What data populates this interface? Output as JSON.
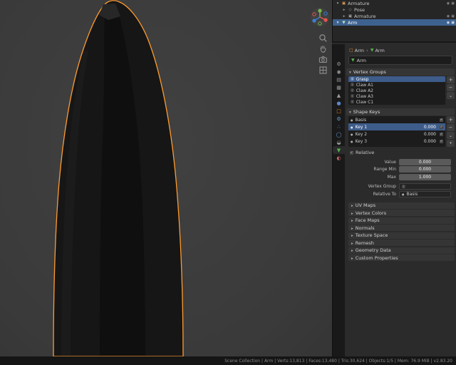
{
  "icons": {
    "armature": "▣",
    "pose": "◇",
    "mesh": "▼",
    "object": "□",
    "group": "▥",
    "shapekey": "●",
    "eye": "◉",
    "screen": "▣"
  },
  "outliner": {
    "rows": [
      {
        "label": "Armature"
      },
      {
        "label": "Pose"
      },
      {
        "label": "Armature"
      },
      {
        "label": "Arm"
      }
    ]
  },
  "tabs": [
    {
      "name": "tool",
      "glyph": "⚙"
    },
    {
      "name": "render",
      "glyph": "◉"
    },
    {
      "name": "output",
      "glyph": "▤"
    },
    {
      "name": "view-layer",
      "glyph": "▦"
    },
    {
      "name": "scene",
      "glyph": "▲"
    },
    {
      "name": "world",
      "glyph": "●"
    },
    {
      "name": "object",
      "glyph": "□"
    },
    {
      "name": "modifiers",
      "glyph": "⚙"
    },
    {
      "name": "particles",
      "glyph": "∴"
    },
    {
      "name": "physics",
      "glyph": "◯"
    },
    {
      "name": "constraints",
      "glyph": "◒"
    },
    {
      "name": "object-data",
      "glyph": "▼"
    },
    {
      "name": "material",
      "glyph": "◐"
    }
  ],
  "properties": {
    "breadcrumb": {
      "object_label": "Arm",
      "data_label": "Arm"
    },
    "name_field": {
      "value": "Arm"
    },
    "vertex_groups": {
      "title": "Vertex Groups",
      "items": [
        {
          "name": "Grasp"
        },
        {
          "name": "Claw A1"
        },
        {
          "name": "Claw A2"
        },
        {
          "name": "Claw A3"
        },
        {
          "name": "Claw C1"
        }
      ]
    },
    "shape_keys": {
      "title": "Shape Keys",
      "items": [
        {
          "name": "Basis",
          "value": ""
        },
        {
          "name": "Key 1",
          "value": "0.000"
        },
        {
          "name": "Key 2",
          "value": "0.000"
        },
        {
          "name": "Key 3",
          "value": "0.000"
        }
      ],
      "relative_label": "Relative",
      "value_label": "Value",
      "value": "0.000",
      "range_min_label": "Range Min",
      "range_min": "0.000",
      "max_label": "Max",
      "max": "1.000",
      "vertex_group_label": "Vertex Group",
      "vertex_group": "",
      "relative_to_label": "Relative To",
      "relative_to": "Basis"
    },
    "panels": [
      "UV Maps",
      "Vertex Colors",
      "Face Maps",
      "Normals",
      "Texture Space",
      "Remesh",
      "Geometry Data",
      "Custom Properties"
    ]
  },
  "statusbar": {
    "text": "Scene Collection | Arm | Verts:13,813 | Faces:13,480 | Tris:30,624 | Objects:1/5 | Mem: 76.9 MiB | v2.83.20"
  },
  "colors": {
    "selection_outline": "#ff9b30",
    "active_row": "#3e6290",
    "data_tab_green": "#57b04f"
  }
}
